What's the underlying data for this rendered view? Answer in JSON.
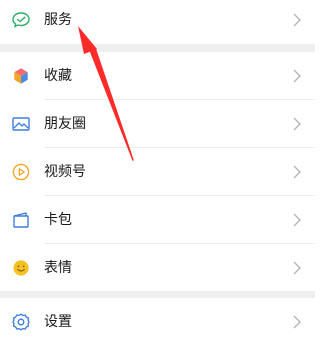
{
  "menu": {
    "services": {
      "label": "服务",
      "icon": "wechat-pay-icon",
      "color": "#2aae67"
    },
    "favorites": {
      "label": "收藏",
      "icon": "cube-icon"
    },
    "moments": {
      "label": "朋友圈",
      "icon": "picture-icon",
      "color": "#3b7ddd"
    },
    "channels": {
      "label": "视频号",
      "icon": "play-icon",
      "color": "#f5a623"
    },
    "cards": {
      "label": "卡包",
      "icon": "wallet-icon",
      "color": "#3b7ddd"
    },
    "stickers": {
      "label": "表情",
      "icon": "smiley-icon",
      "color": "#f5c223"
    },
    "settings": {
      "label": "设置",
      "icon": "gear-icon",
      "color": "#3b7ddd"
    }
  },
  "colors": {
    "annotation_arrow": "#ff2a2a",
    "section_gap": "#efefef",
    "chevron": "#b2b2b2"
  }
}
